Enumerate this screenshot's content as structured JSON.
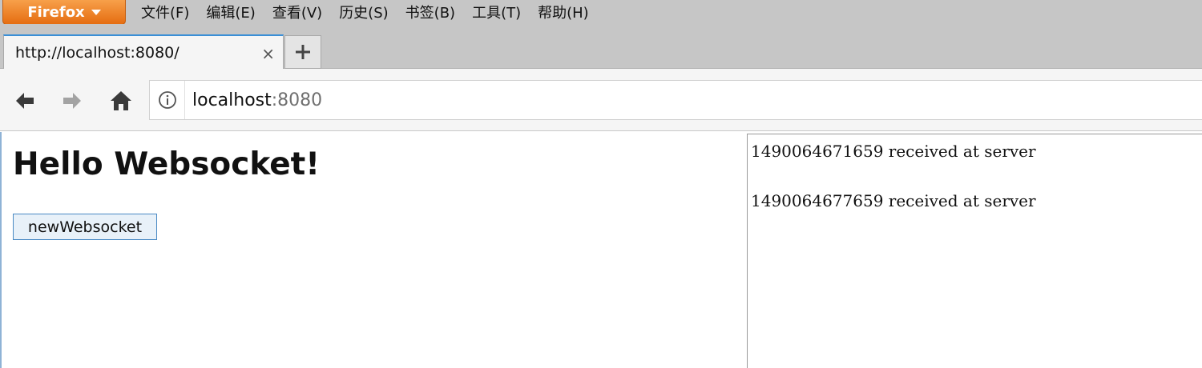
{
  "app": {
    "name": "Firefox"
  },
  "menu": [
    "文件(F)",
    "编辑(E)",
    "查看(V)",
    "历史(S)",
    "书签(B)",
    "工具(T)",
    "帮助(H)"
  ],
  "tab": {
    "title": "http://localhost:8080/",
    "close": "×"
  },
  "urlbar": {
    "host": "localhost",
    "port": ":8080"
  },
  "page": {
    "heading": "Hello Websocket!",
    "button_label": "newWebsocket",
    "log": [
      "1490064671659 received at server",
      "1490064677659 received at server"
    ]
  },
  "colors": {
    "firefox_button": "#e56d11",
    "tab_accent": "#3b8fd6",
    "button_border": "#4a8ac4"
  }
}
